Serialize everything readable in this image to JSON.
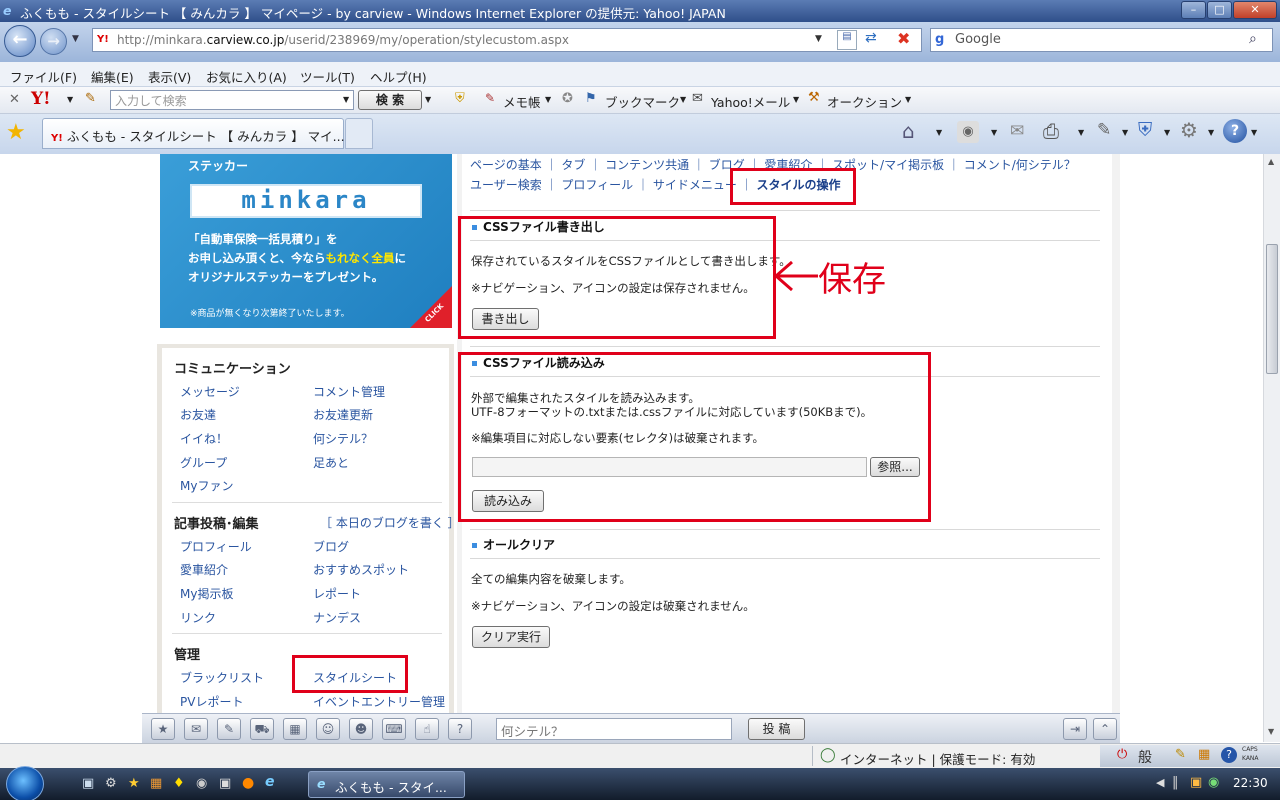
{
  "window": {
    "title": "ふくもも - スタイルシート 【 みんカラ 】 マイページ - by carview - Windows Internet Explorer の提供元: Yahoo! JAPAN"
  },
  "address": {
    "url_prefix": "http://minkara.",
    "url_domain": "carview.co.jp",
    "url_path": "/userid/238969/my/operation/stylecustom.aspx"
  },
  "search": {
    "engine": "Google"
  },
  "menu": [
    "ファイル(F)",
    "編集(E)",
    "表示(V)",
    "お気に入り(A)",
    "ツール(T)",
    "ヘルプ(H)"
  ],
  "ytoolbar": {
    "placeholder": "入力して検索",
    "search_button": "検 索",
    "memo": "メモ帳",
    "bookmark": "ブックマーク",
    "mail": "Yahoo!メール",
    "auction": "オークション"
  },
  "tab": {
    "label": "ふくもも - スタイルシート 【 みんカラ 】 マイ..."
  },
  "banner": {
    "sticker": "ステッカー",
    "logo": "minkara",
    "line1": "「自動車保険一括見積り」を",
    "line2": "お申し込み頂くと、今なら",
    "highlight": "もれなく全員",
    "line2b": "に",
    "line3": "オリジナルステッカーをプレゼント。",
    "note": "※商品が無くなり次第終了いたします。",
    "click": "CLICK"
  },
  "sidebar": {
    "communication": {
      "heading": "コミュニケーション",
      "links": [
        "メッセージ",
        "コメント管理",
        "お友達",
        "お友達更新",
        "イイね！",
        "何シテル？",
        "グループ",
        "足あと",
        "Myファン"
      ]
    },
    "posting": {
      "heading": "記事投稿･編集",
      "write_link": "［ 本日のブログを書く ］",
      "links": [
        "プロフィール",
        "ブログ",
        "愛車紹介",
        "おすすめスポット",
        "My掲示板",
        "レポート",
        "リンク",
        "ナンデス"
      ]
    },
    "admin": {
      "heading": "管理",
      "links": [
        "ブラックリスト",
        "スタイルシート",
        "PVレポート",
        "イベントエントリー管理"
      ]
    }
  },
  "subnav": {
    "row1": [
      "ページの基本",
      "タブ",
      "コンテンツ共通",
      "ブログ",
      "愛車紹介",
      "スポット/マイ掲示板",
      "コメント/何シテル？"
    ],
    "row2": [
      "ユーザー検索",
      "プロフィール",
      "サイドメニュー"
    ],
    "active": "スタイルの操作"
  },
  "export": {
    "heading": "CSSファイル書き出し",
    "desc": "保存されているスタイルをCSSファイルとして書き出します。",
    "note": "※ナビゲーション、アイコンの設定は保存されません。",
    "button": "書き出し"
  },
  "annotation": {
    "text": "保存",
    "color": "#e0001a"
  },
  "import": {
    "heading": "CSSファイル読み込み",
    "desc1": "外部で編集されたスタイルを読み込みます。",
    "desc2": "UTF-8フォーマットの.txtまたは.cssファイルに対応しています(50KBまで)。",
    "note": "※編集項目に対応しない要素(セレクタ)は破棄されます。",
    "browse": "参照...",
    "button": "読み込み"
  },
  "clear": {
    "heading": "オールクリア",
    "desc": "全ての編集内容を破棄します。",
    "note": "※ナビゲーション、アイコンの設定は破棄されません。",
    "button": "クリア実行"
  },
  "bottombar": {
    "placeholder": "何シテル？",
    "post": "投 稿"
  },
  "status": {
    "zone": "インターネット | 保護モード: 有効"
  },
  "taskbar": {
    "task": "ふくもも - スタイ...",
    "time": "22:30",
    "ime": "般",
    "caps": "CAPS",
    "kana": "KANA"
  }
}
